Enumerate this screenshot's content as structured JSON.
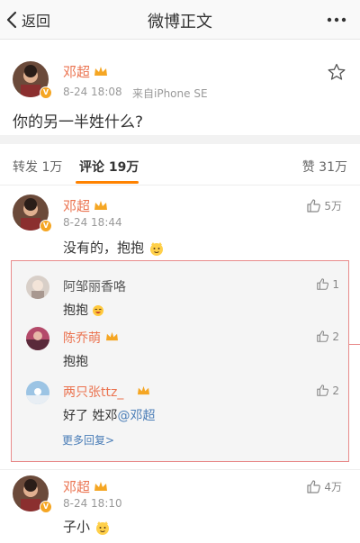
{
  "navbar": {
    "back_label": "返回",
    "title": "微博正文"
  },
  "post": {
    "author": "邓超",
    "time": "8-24 18:08",
    "source": "来自iPhone SE",
    "text": "你的另一半姓什么?"
  },
  "tabs": {
    "repost": "转发 1万",
    "comment": "评论 19万",
    "like": "赞 31万"
  },
  "comments": [
    {
      "author": "邓超",
      "time": "8-24 18:44",
      "likes": "5万",
      "text": "没有的，抱抱",
      "replies": [
        {
          "author": "阿邹丽香咯",
          "text": "抱抱",
          "likes": "1"
        },
        {
          "author": "陈乔萌",
          "text": "抱抱",
          "likes": "2"
        },
        {
          "author": "两只张ttz_",
          "text_prefix": "好了 姓邓",
          "mention": "@邓超",
          "likes": "2"
        }
      ],
      "more_replies": "更多回复>"
    },
    {
      "author": "邓超",
      "time": "8-24 18:10",
      "likes": "4万",
      "text": "子小"
    }
  ],
  "colors": {
    "accent": "#ff8200",
    "username": "#eb7350",
    "link": "#4a7db7",
    "highlight_border": "#e88b8b"
  }
}
